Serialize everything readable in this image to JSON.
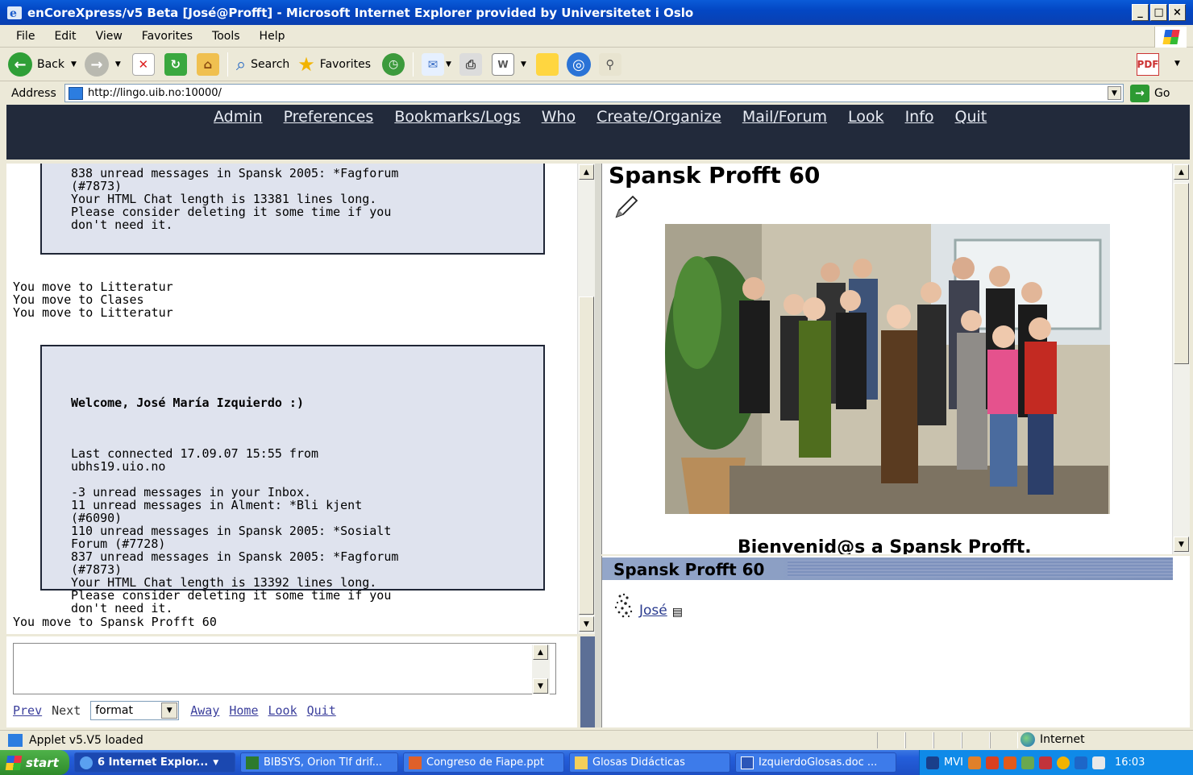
{
  "window": {
    "title": "enCoreXpress/v5 Beta [José@Profft] - Microsoft Internet Explorer provided by Universitetet i Oslo",
    "controls": [
      "_",
      "□",
      "×"
    ]
  },
  "menu": [
    "File",
    "Edit",
    "View",
    "Favorites",
    "Tools",
    "Help"
  ],
  "toolbar": {
    "back": "Back",
    "search": "Search",
    "favorites": "Favorites"
  },
  "address": {
    "label": "Address",
    "url": "http://lingo.uib.no:10000/",
    "go": "Go"
  },
  "sitenav": [
    "Admin",
    "Preferences",
    "Bookmarks/Logs",
    "Who",
    "Create/Organize",
    "Mail/Forum",
    "Look",
    "Info",
    "Quit"
  ],
  "chat": {
    "box1": "838 unread messages in Spansk 2005: *Fagforum\n(#7873)\nYour HTML Chat length is 13381 lines long.\nPlease consider deleting it some time if you\ndon't need it.",
    "moves1": "You move to Litteratur\nYou move to Clases\nYou move to Litteratur",
    "welcome": "Welcome, José María Izquierdo :)",
    "box2": "Last connected 17.09.07 15:55 from\nubhs19.uio.no\n\n-3 unread messages in your Inbox.\n11 unread messages in Alment: *Bli kjent\n(#6090)\n110 unread messages in Spansk 2005: *Sosialt\nForum (#7728)\n837 unread messages in Spansk 2005: *Fagforum\n(#7873)\nYour HTML Chat length is 13392 lines long.\nPlease consider deleting it some time if you\ndon't need it.",
    "moves2": "You move to Spansk Profft 60"
  },
  "controls": {
    "prev": "Prev",
    "next": "Next",
    "format": "format",
    "away": "Away",
    "home": "Home",
    "look": "Look",
    "quit": "Quit"
  },
  "room": {
    "title": "Spansk Profft 60",
    "welcome": "Bienvenid@s a Spansk Profft."
  },
  "who": {
    "header": "Spansk Profft 60",
    "user": "José"
  },
  "status": {
    "text": "Applet v5.V5 loaded",
    "zone": "Internet"
  },
  "taskbar": {
    "start": "start",
    "tasks": [
      "6 Internet Explor...",
      "BIBSYS, Orion Tlf drif...",
      "Congreso de Fiape.ppt",
      "Glosas Didácticas",
      "IzquierdoGlosas.doc ..."
    ],
    "tray_label": "MVI",
    "clock": "16:03"
  },
  "colors": {
    "sitenav_bg": "#222a3b",
    "chat_box_bg": "#dfe3ee",
    "who_header": "#8a9cc3"
  }
}
